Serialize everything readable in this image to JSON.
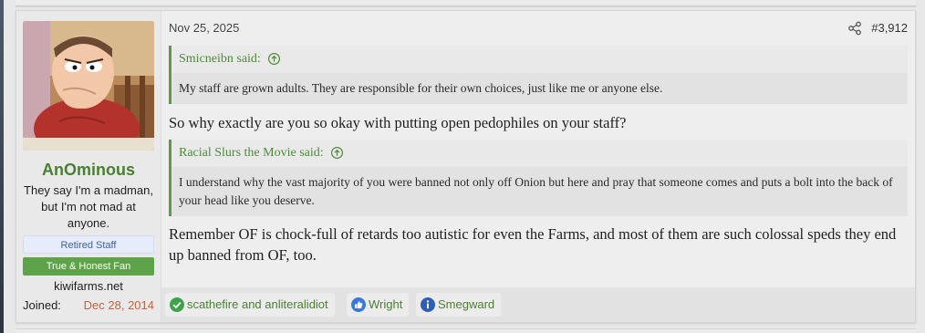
{
  "post": {
    "date": "Nov 25, 2025",
    "number": "#3,912",
    "share_icon": "share-icon"
  },
  "user": {
    "username": "AnOminous",
    "title": "They say I'm a madman, but I'm not mad at anyone.",
    "banners": [
      "Retired Staff",
      "True & Honest Fan"
    ],
    "site": "kiwifarms.net",
    "joined_label": "Joined:",
    "joined_value": "Dec 28, 2014"
  },
  "quotes": [
    {
      "author": "Smicneibn said:",
      "text": "My staff are grown adults. They are responsible for their own choices, just like me or anyone else."
    },
    {
      "author": "Racial Slurs the Movie said:",
      "text": "I understand why the vast majority of you were banned not only off Onion but here and pray that someone comes and puts a bolt into the back of your head like you deserve."
    }
  ],
  "body": [
    "So why exactly are you so okay with putting open pedophiles on your staff?",
    "Remember OF is chock-full of retards too autistic for even the Farms, and most of them are such colossal speds they end up banned from OF, too."
  ],
  "reactions": [
    {
      "icon": "checkmark-icon",
      "label": "scathefire and anliteralidiot"
    },
    {
      "icon": "thumbs-up-icon",
      "label": "Wright"
    },
    {
      "icon": "info-icon",
      "label": "Smegward"
    }
  ],
  "colors": {
    "accent_green": "#4a7f32",
    "quote_border": "#5c9a46",
    "joined_date": "#c4633b",
    "staff_banner_text": "#3b5fa8",
    "fan_banner_bg": "#5ea34a"
  }
}
